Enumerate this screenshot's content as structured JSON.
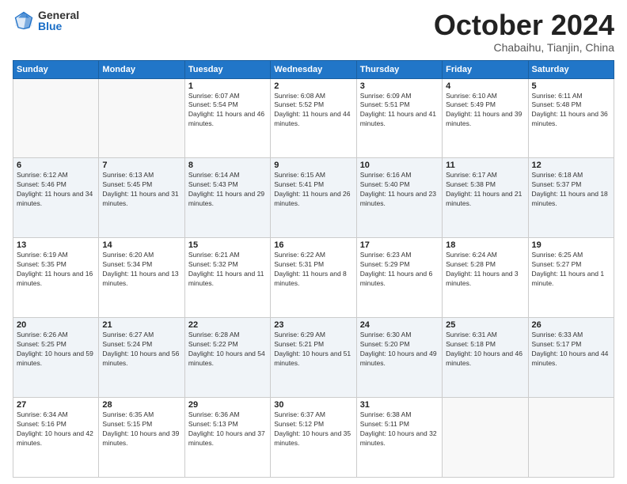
{
  "header": {
    "logo_general": "General",
    "logo_blue": "Blue",
    "month_title": "October 2024",
    "location": "Chabaihu, Tianjin, China"
  },
  "weekdays": [
    "Sunday",
    "Monday",
    "Tuesday",
    "Wednesday",
    "Thursday",
    "Friday",
    "Saturday"
  ],
  "weeks": [
    [
      {
        "day": "",
        "info": ""
      },
      {
        "day": "",
        "info": ""
      },
      {
        "day": "1",
        "info": "Sunrise: 6:07 AM\nSunset: 5:54 PM\nDaylight: 11 hours and 46 minutes."
      },
      {
        "day": "2",
        "info": "Sunrise: 6:08 AM\nSunset: 5:52 PM\nDaylight: 11 hours and 44 minutes."
      },
      {
        "day": "3",
        "info": "Sunrise: 6:09 AM\nSunset: 5:51 PM\nDaylight: 11 hours and 41 minutes."
      },
      {
        "day": "4",
        "info": "Sunrise: 6:10 AM\nSunset: 5:49 PM\nDaylight: 11 hours and 39 minutes."
      },
      {
        "day": "5",
        "info": "Sunrise: 6:11 AM\nSunset: 5:48 PM\nDaylight: 11 hours and 36 minutes."
      }
    ],
    [
      {
        "day": "6",
        "info": "Sunrise: 6:12 AM\nSunset: 5:46 PM\nDaylight: 11 hours and 34 minutes."
      },
      {
        "day": "7",
        "info": "Sunrise: 6:13 AM\nSunset: 5:45 PM\nDaylight: 11 hours and 31 minutes."
      },
      {
        "day": "8",
        "info": "Sunrise: 6:14 AM\nSunset: 5:43 PM\nDaylight: 11 hours and 29 minutes."
      },
      {
        "day": "9",
        "info": "Sunrise: 6:15 AM\nSunset: 5:41 PM\nDaylight: 11 hours and 26 minutes."
      },
      {
        "day": "10",
        "info": "Sunrise: 6:16 AM\nSunset: 5:40 PM\nDaylight: 11 hours and 23 minutes."
      },
      {
        "day": "11",
        "info": "Sunrise: 6:17 AM\nSunset: 5:38 PM\nDaylight: 11 hours and 21 minutes."
      },
      {
        "day": "12",
        "info": "Sunrise: 6:18 AM\nSunset: 5:37 PM\nDaylight: 11 hours and 18 minutes."
      }
    ],
    [
      {
        "day": "13",
        "info": "Sunrise: 6:19 AM\nSunset: 5:35 PM\nDaylight: 11 hours and 16 minutes."
      },
      {
        "day": "14",
        "info": "Sunrise: 6:20 AM\nSunset: 5:34 PM\nDaylight: 11 hours and 13 minutes."
      },
      {
        "day": "15",
        "info": "Sunrise: 6:21 AM\nSunset: 5:32 PM\nDaylight: 11 hours and 11 minutes."
      },
      {
        "day": "16",
        "info": "Sunrise: 6:22 AM\nSunset: 5:31 PM\nDaylight: 11 hours and 8 minutes."
      },
      {
        "day": "17",
        "info": "Sunrise: 6:23 AM\nSunset: 5:29 PM\nDaylight: 11 hours and 6 minutes."
      },
      {
        "day": "18",
        "info": "Sunrise: 6:24 AM\nSunset: 5:28 PM\nDaylight: 11 hours and 3 minutes."
      },
      {
        "day": "19",
        "info": "Sunrise: 6:25 AM\nSunset: 5:27 PM\nDaylight: 11 hours and 1 minute."
      }
    ],
    [
      {
        "day": "20",
        "info": "Sunrise: 6:26 AM\nSunset: 5:25 PM\nDaylight: 10 hours and 59 minutes."
      },
      {
        "day": "21",
        "info": "Sunrise: 6:27 AM\nSunset: 5:24 PM\nDaylight: 10 hours and 56 minutes."
      },
      {
        "day": "22",
        "info": "Sunrise: 6:28 AM\nSunset: 5:22 PM\nDaylight: 10 hours and 54 minutes."
      },
      {
        "day": "23",
        "info": "Sunrise: 6:29 AM\nSunset: 5:21 PM\nDaylight: 10 hours and 51 minutes."
      },
      {
        "day": "24",
        "info": "Sunrise: 6:30 AM\nSunset: 5:20 PM\nDaylight: 10 hours and 49 minutes."
      },
      {
        "day": "25",
        "info": "Sunrise: 6:31 AM\nSunset: 5:18 PM\nDaylight: 10 hours and 46 minutes."
      },
      {
        "day": "26",
        "info": "Sunrise: 6:33 AM\nSunset: 5:17 PM\nDaylight: 10 hours and 44 minutes."
      }
    ],
    [
      {
        "day": "27",
        "info": "Sunrise: 6:34 AM\nSunset: 5:16 PM\nDaylight: 10 hours and 42 minutes."
      },
      {
        "day": "28",
        "info": "Sunrise: 6:35 AM\nSunset: 5:15 PM\nDaylight: 10 hours and 39 minutes."
      },
      {
        "day": "29",
        "info": "Sunrise: 6:36 AM\nSunset: 5:13 PM\nDaylight: 10 hours and 37 minutes."
      },
      {
        "day": "30",
        "info": "Sunrise: 6:37 AM\nSunset: 5:12 PM\nDaylight: 10 hours and 35 minutes."
      },
      {
        "day": "31",
        "info": "Sunrise: 6:38 AM\nSunset: 5:11 PM\nDaylight: 10 hours and 32 minutes."
      },
      {
        "day": "",
        "info": ""
      },
      {
        "day": "",
        "info": ""
      }
    ]
  ]
}
